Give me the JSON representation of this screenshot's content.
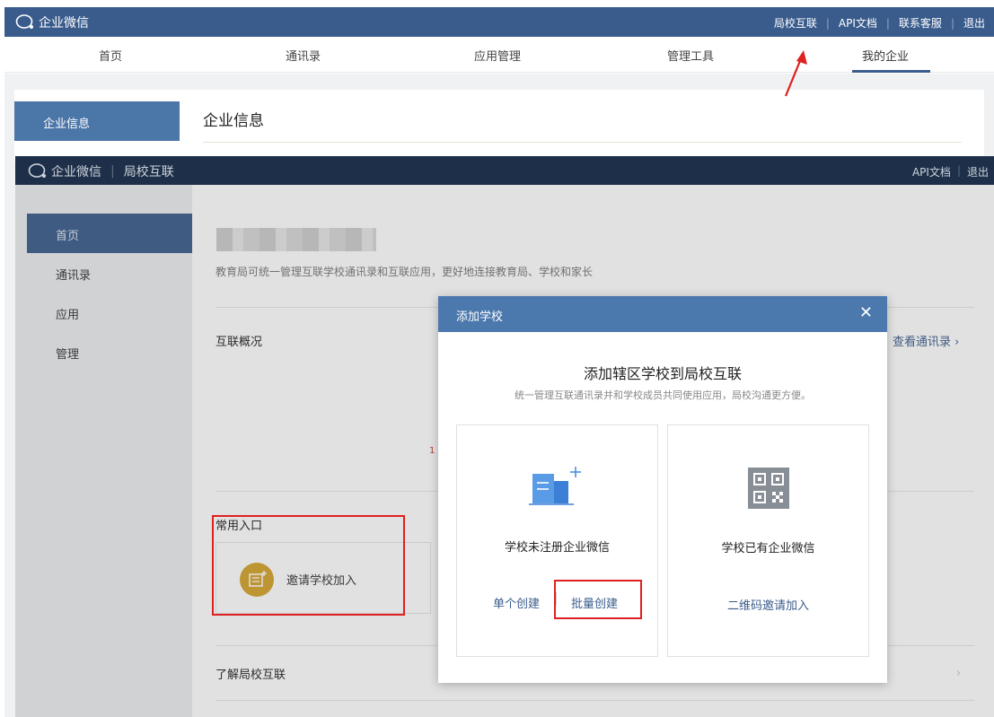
{
  "bg": {
    "logo_text": "企业微信",
    "top_links": [
      "局校互联",
      "API文档",
      "联系客服",
      "退出"
    ],
    "nav_tabs": [
      "首页",
      "通讯录",
      "应用管理",
      "管理工具",
      "我的企业"
    ],
    "sidebar_active": "企业信息",
    "panel_title": "企业信息"
  },
  "shot2": {
    "logo_text": "企业微信",
    "logo_sub": "局校互联",
    "top_links": [
      "API文档",
      "退出"
    ],
    "sidebar": [
      "首页",
      "通讯录",
      "应用",
      "管理"
    ],
    "description": "教育局可统一管理互联学校通讯录和互联应用，更好地连接教育局、学校和家长",
    "section_overview": "互联概况",
    "view_contacts": "查看通讯录 ›",
    "section_common": "常用入口",
    "invite_card": "邀请学校加入",
    "section_learn": "了解局校互联",
    "stray_mark": "1"
  },
  "modal": {
    "header": "添加学校",
    "close": "✕",
    "title": "添加辖区学校到局校互联",
    "subtitle": "统一管理互联通讯录并和学校成员共同使用应用，局校沟通更方便。",
    "option1": {
      "label": "学校未注册企业微信",
      "link1": "单个创建",
      "link2": "批量创建"
    },
    "option2": {
      "label": "学校已有企业微信",
      "link": "二维码邀请加入"
    }
  },
  "colors": {
    "topbar": "#3a5c8c",
    "topbar_dark": "#1e3049",
    "accent": "#4b78ad",
    "annotation_red": "#e02020",
    "invite_icon": "#d4a32a"
  }
}
